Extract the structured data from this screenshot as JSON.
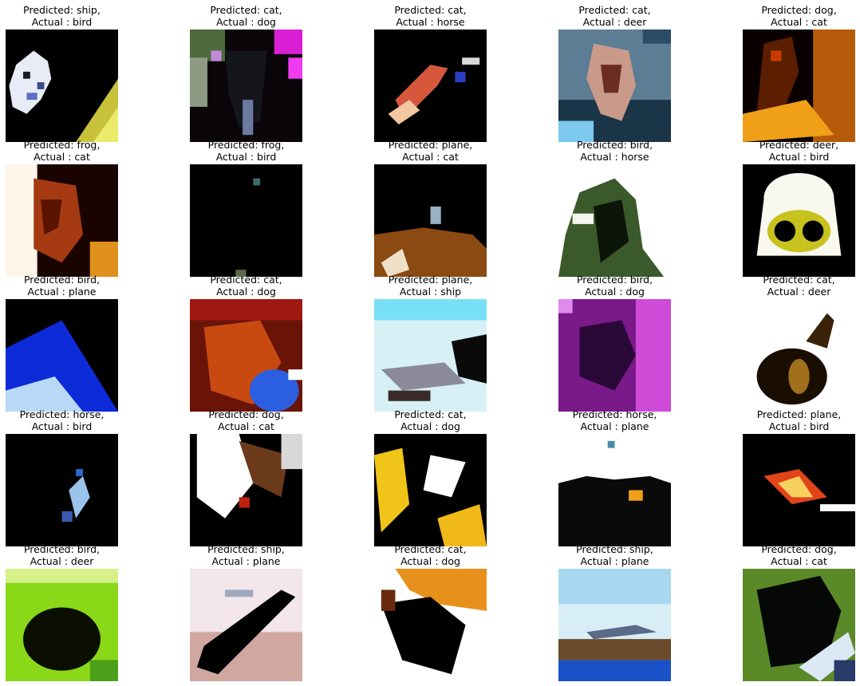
{
  "figure": {
    "panels": [
      {
        "predicted": "Predicted: ship,",
        "actual": "Actual : bird",
        "image": "predicted-ship-actual-bird"
      },
      {
        "predicted": "Predicted: cat,",
        "actual": "Actual : dog",
        "image": "predicted-cat-actual-dog"
      },
      {
        "predicted": "Predicted: cat,",
        "actual": "Actual : horse",
        "image": "predicted-cat-actual-horse"
      },
      {
        "predicted": "Predicted: cat,",
        "actual": "Actual : deer",
        "image": "predicted-cat-actual-deer"
      },
      {
        "predicted": "Predicted: dog,",
        "actual": "Actual : cat",
        "image": "predicted-dog-actual-cat"
      },
      {
        "predicted": "Predicted: frog,",
        "actual": "Actual : cat",
        "image": "predicted-frog-actual-cat"
      },
      {
        "predicted": "Predicted: frog,",
        "actual": "Actual : bird",
        "image": "predicted-frog-actual-bird"
      },
      {
        "predicted": "Predicted: plane,",
        "actual": "Actual : cat",
        "image": "predicted-plane-actual-cat"
      },
      {
        "predicted": "Predicted: bird,",
        "actual": "Actual : horse",
        "image": "predicted-bird-actual-horse"
      },
      {
        "predicted": "Predicted: deer,",
        "actual": "Actual : bird",
        "image": "predicted-deer-actual-bird"
      },
      {
        "predicted": "Predicted: bird,",
        "actual": "Actual : plane",
        "image": "predicted-bird-actual-plane"
      },
      {
        "predicted": "Predicted: cat,",
        "actual": "Actual : dog",
        "image": "predicted-cat-actual-dog"
      },
      {
        "predicted": "Predicted: plane,",
        "actual": "Actual : ship",
        "image": "predicted-plane-actual-ship"
      },
      {
        "predicted": "Predicted: bird,",
        "actual": "Actual : dog",
        "image": "predicted-bird-actual-dog"
      },
      {
        "predicted": "Predicted: cat,",
        "actual": "Actual : deer",
        "image": "predicted-cat-actual-deer"
      },
      {
        "predicted": "Predicted: horse,",
        "actual": "Actual : bird",
        "image": "predicted-horse-actual-bird"
      },
      {
        "predicted": "Predicted: dog,",
        "actual": "Actual : cat",
        "image": "predicted-dog-actual-cat"
      },
      {
        "predicted": "Predicted: cat,",
        "actual": "Actual : dog",
        "image": "predicted-cat-actual-dog"
      },
      {
        "predicted": "Predicted: horse,",
        "actual": "Actual : plane",
        "image": "predicted-horse-actual-plane"
      },
      {
        "predicted": "Predicted: plane,",
        "actual": "Actual : bird",
        "image": "predicted-plane-actual-bird"
      },
      {
        "predicted": "Predicted: bird,",
        "actual": "Actual : deer",
        "image": "predicted-bird-actual-deer"
      },
      {
        "predicted": "Predicted: ship,",
        "actual": "Actual : plane",
        "image": "predicted-ship-actual-plane"
      },
      {
        "predicted": "Predicted: cat,",
        "actual": "Actual : dog",
        "image": "predicted-cat-actual-dog"
      },
      {
        "predicted": "Predicted: ship,",
        "actual": "Actual : plane",
        "image": "predicted-ship-actual-plane"
      },
      {
        "predicted": "Predicted: dog,",
        "actual": "Actual : cat",
        "image": "predicted-dog-actual-cat"
      }
    ]
  }
}
